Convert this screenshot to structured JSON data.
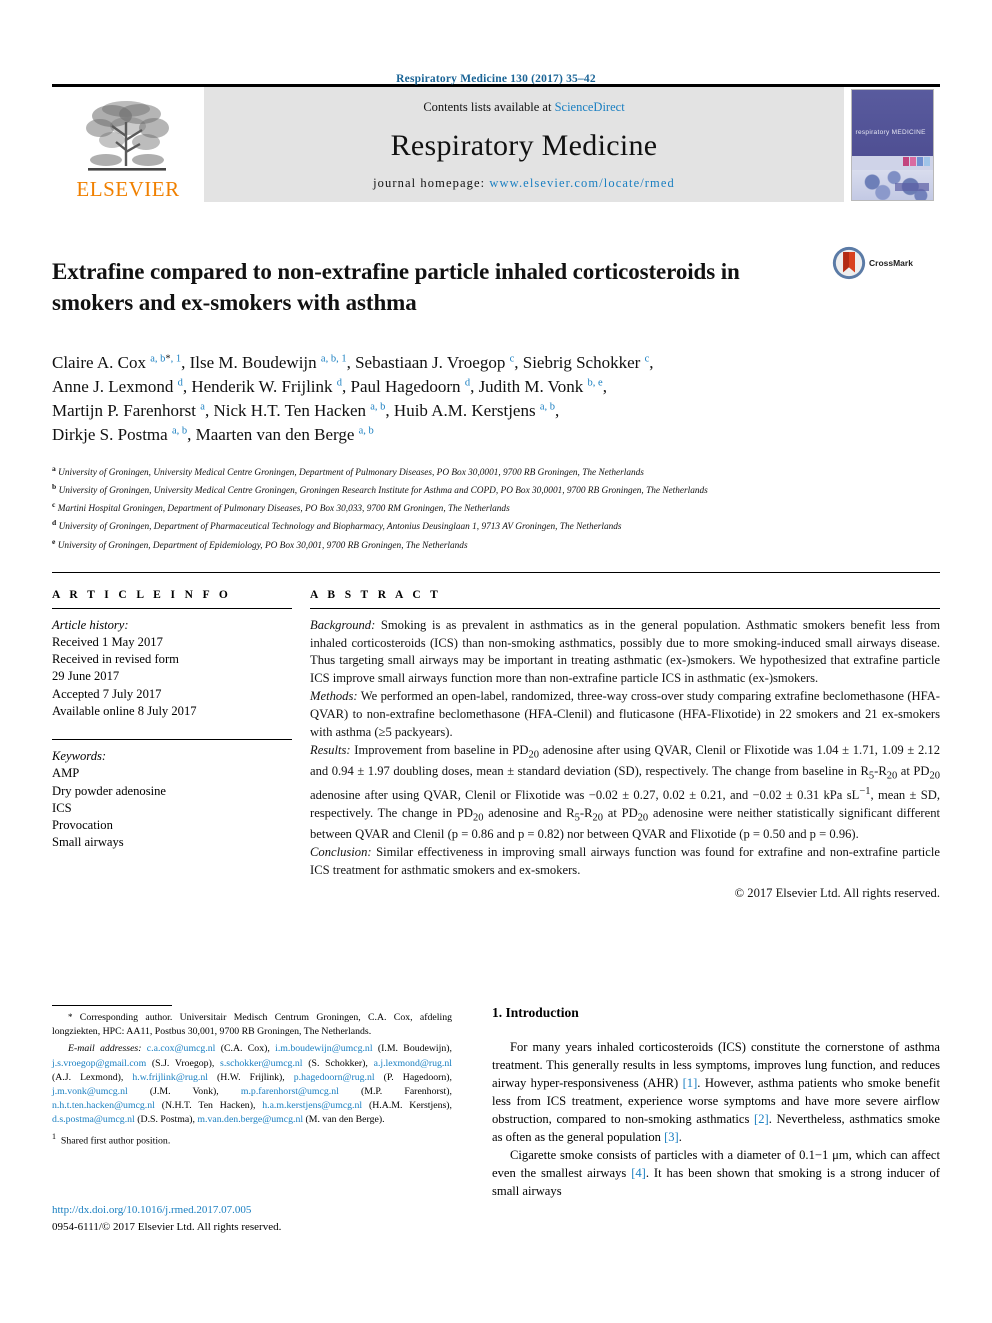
{
  "running_head": "Respiratory Medicine 130 (2017) 35–42",
  "masthead": {
    "publisher_logo_text": "ELSEVIER",
    "contents_prefix": "Contents lists available at ",
    "contents_link": "ScienceDirect",
    "journal_name": "Respiratory Medicine",
    "homepage_prefix": "journal homepage: ",
    "homepage_url": "www.elsevier.com/locate/rmed",
    "cover_title": "respiratory MEDICINE"
  },
  "crossmark": {
    "label": "CrossMark"
  },
  "article": {
    "title": "Extrafine compared to non-extrafine particle inhaled corticosteroids in smokers and ex-smokers with asthma",
    "authors_html": "Claire A. Cox <sup class=\"sup\">a, b</sup><sup class=\"sup-blk\">*</sup><sup class=\"sup\">, 1</sup>, Ilse M. Boudewijn <sup class=\"sup\">a, b, 1</sup>, Sebastiaan J. Vroegop <sup class=\"sup\">c</sup>, Siebrig Schokker <sup class=\"sup\">c</sup>,<br>Anne J. Lexmond <sup class=\"sup\">d</sup>, Henderik W. Frijlink <sup class=\"sup\">d</sup>, Paul Hagedoorn <sup class=\"sup\">d</sup>, Judith M. Vonk <sup class=\"sup\">b, e</sup>,<br>Martijn P. Farenhorst <sup class=\"sup\">a</sup>, Nick H.T. Ten Hacken <sup class=\"sup\">a, b</sup>, Huib A.M. Kerstjens <sup class=\"sup\">a, b</sup>,<br>Dirkje S. Postma <sup class=\"sup\">a, b</sup>, Maarten van den Berge <sup class=\"sup\">a, b</sup>",
    "affiliations": [
      {
        "mark": "a",
        "text": "University of Groningen, University Medical Centre Groningen, Department of Pulmonary Diseases, PO Box 30,0001, 9700 RB Groningen, The Netherlands"
      },
      {
        "mark": "b",
        "text": "University of Groningen, University Medical Centre Groningen, Groningen Research Institute for Asthma and COPD, PO Box 30,0001, 9700 RB Groningen, The Netherlands"
      },
      {
        "mark": "c",
        "text": "Martini Hospital Groningen, Department of Pulmonary Diseases, PO Box 30,033, 9700 RM Groningen, The Netherlands"
      },
      {
        "mark": "d",
        "text": "University of Groningen, Department of Pharmaceutical Technology and Biopharmacy, Antonius Deusinglaan 1, 9713 AV Groningen, The Netherlands"
      },
      {
        "mark": "e",
        "text": "University of Groningen, Department of Epidemiology, PO Box 30,001, 9700 RB Groningen, The Netherlands"
      }
    ]
  },
  "article_info": {
    "heading": "A R T I C L E   I N F O",
    "history_label": "Article history:",
    "history": [
      "Received 1 May 2017",
      "Received in revised form",
      "29 June 2017",
      "Accepted 7 July 2017",
      "Available online 8 July 2017"
    ],
    "keywords_label": "Keywords:",
    "keywords": [
      "AMP",
      "Dry powder adenosine",
      "ICS",
      "Provocation",
      "Small airways"
    ]
  },
  "abstract": {
    "heading": "A B S T R A C T",
    "background_label": "Background:",
    "background": " Smoking is as prevalent in asthmatics as in the general population. Asthmatic smokers benefit less from inhaled corticosteroids (ICS) than non-smoking asthmatics, possibly due to more smoking-induced small airways disease. Thus targeting small airways may be important in treating asthmatic (ex-)smokers. We hypothesized that extrafine particle ICS improve small airways function more than non-extrafine particle ICS in asthmatic (ex-)smokers.",
    "methods_label": "Methods:",
    "methods": " We performed an open-label, randomized, three-way cross-over study comparing extrafine beclomethasone (HFA-QVAR) to non-extrafine beclomethasone (HFA-Clenil) and fluticasone (HFA-Flixotide) in 22 smokers and 21 ex-smokers with asthma (≥5 packyears).",
    "results_label": "Results:",
    "results_html": " Improvement from baseline in PD<sub>20</sub> adenosine after using QVAR, Clenil or Flixotide was 1.04 &plusmn; 1.71, 1.09 &plusmn; 2.12 and 0.94 &plusmn; 1.97 doubling doses, mean &plusmn; standard deviation (SD), respectively. The change from baseline in R<sub>5</sub>-R<sub>20</sub> at PD<sub>20</sub> adenosine after using QVAR, Clenil or Flixotide was &minus;0.02 &plusmn; 0.27, 0.02 &plusmn; 0.21, and &minus;0.02 &plusmn; 0.31 kPa sL<sup>&minus;1</sup>, mean &plusmn; SD, respectively. The change in PD<sub>20</sub> adenosine and R<sub>5</sub>-R<sub>20</sub> at PD<sub>20</sub> adenosine were neither statistically significant different between QVAR and Clenil (p = 0.86 and p = 0.82) nor between QVAR and Flixotide (p = 0.50 and p = 0.96).",
    "conclusion_label": "Conclusion:",
    "conclusion": " Similar effectiveness in improving small airways function was found for extrafine and non-extrafine particle ICS treatment for asthmatic smokers and ex-smokers.",
    "copyright": "© 2017 Elsevier Ltd. All rights reserved."
  },
  "footnote": {
    "corresponding_html": "<span class=\"star\">*</span> Corresponding author. Universitair Medisch Centrum Groningen, C.A. Cox, afdeling longziekten, HPC: AA11, Postbus 30,001, 9700 RB Groningen, The Netherlands.",
    "emails_html": "<span style=\"font-style:italic\">E-mail addresses:</span> <span class=\"mail\">c.a.cox@umcg.nl</span> (C.A. Cox), <span class=\"mail\">i.m.boudewijn@umcg.nl</span> (I.M. Boudewijn), <span class=\"mail\">j.s.vroegop@gmail.com</span> (S.J. Vroegop), <span class=\"mail\">s.schokker@umcg.nl</span> (S. Schokker), <span class=\"mail\">a.j.lexmond@rug.nl</span> (A.J. Lexmond), <span class=\"mail\">h.w.frijlink@rug.nl</span> (H.W. Frijlink), <span class=\"mail\">p.hagedoorn@rug.nl</span> (P. Hagedoorn), <span class=\"mail\">j.m.vonk@umcg.nl</span> (J.M. Vonk), <span class=\"mail\">m.p.farenhorst@umcg.nl</span> (M.P. Farenhorst), <span class=\"mail\">n.h.t.ten.hacken@umcg.nl</span> (N.H.T. Ten Hacken), <span class=\"mail\">h.a.m.kerstjens@umcg.nl</span> (H.A.M. Kerstjens), <span class=\"mail\">d.s.postma@umcg.nl</span> (D.S. Postma), <span class=\"mail\">m.van.den.berge@umcg.nl</span> (M. van den Berge).",
    "shared_html": "<sup>1</sup>&nbsp; Shared first author position."
  },
  "doi": {
    "url": "http://dx.doi.org/10.1016/j.rmed.2017.07.005",
    "issn_line": "0954-6111/© 2017 Elsevier Ltd. All rights reserved."
  },
  "introduction": {
    "heading": "1. Introduction",
    "p1_html": "For many years inhaled corticosteroids (ICS) constitute the cornerstone of asthma treatment. This generally results in less symptoms, improves lung function, and reduces airway hyper-responsiveness (AHR) <span class=\"ref\">[1]</span>. However, asthma patients who smoke benefit less from ICS treatment, experience worse symptoms and have more severe airflow obstruction, compared to non-smoking asthmatics <span class=\"ref\">[2]</span>. Nevertheless, asthmatics smoke as often as the general population <span class=\"ref\">[3]</span>.",
    "p2_html": "Cigarette smoke consists of particles with a diameter of 0.1&minus;1 &mu;m, which can affect even the smallest airways <span class=\"ref\">[4]</span>. It has been shown that smoking is a strong inducer of small airways"
  },
  "colors": {
    "link": "#1a7fc1",
    "running_head": "#1a6496",
    "elsevier_orange": "#f08000",
    "masthead_gray": "#e3e3e3"
  }
}
